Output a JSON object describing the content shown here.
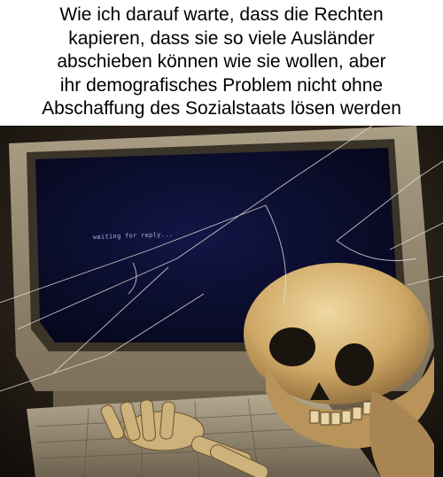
{
  "caption": {
    "lines": [
      "Wie ich darauf warte, dass die Rechten",
      "kapieren, dass sie so viele Ausländer",
      "abschieben können wie sie wollen, aber",
      "ihr demografisches Problem nicht ohne",
      "Abschaffung des Sozialstaats lösen werden"
    ]
  },
  "photo": {
    "screen_text": "waiting for reply..."
  },
  "colors": {
    "background": "#ffffff",
    "text": "#000000",
    "monitor_bezel": "#b8aa8c",
    "screen": "#0a0c26",
    "skull": "#d8b87a"
  }
}
